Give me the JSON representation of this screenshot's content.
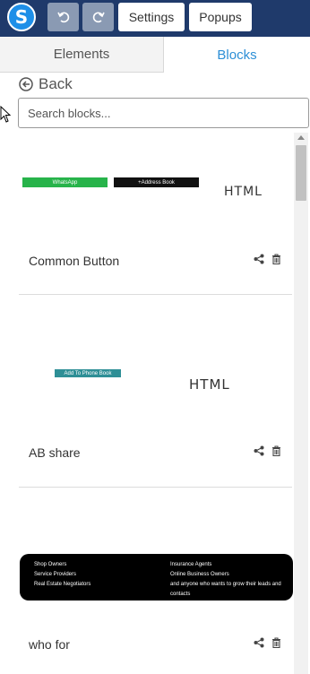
{
  "toolbar": {
    "logo_letter": "S",
    "undo_icon": "undo-icon",
    "redo_icon": "redo-icon",
    "settings_label": "Settings",
    "popups_label": "Popups"
  },
  "tabs": [
    {
      "label": "Elements",
      "active": false
    },
    {
      "label": "Blocks",
      "active": true
    }
  ],
  "back_label": "Back",
  "search": {
    "placeholder": "Search blocks...",
    "value": ""
  },
  "blocks": [
    {
      "name": "Common Button",
      "preview_label": "HTML",
      "preview_buttons": [
        "WhatsApp",
        "+Address Book"
      ]
    },
    {
      "name": "AB share",
      "preview_label": "HTML",
      "preview_buttons": [
        "Add To Phone Book"
      ]
    },
    {
      "name": "who for",
      "preview_left": [
        "Shop Owners",
        "Service Providers",
        "Real Estate Negotiators"
      ],
      "preview_right": [
        "Insurance Agents",
        "Online Business Owners",
        "and anyone who wants to grow their leads and",
        "contacts"
      ]
    }
  ],
  "colors": {
    "topbar": "#1f3a6b",
    "active_tab": "#2d8fd6",
    "whatsapp_green": "#27b34a",
    "teal": "#2e8f96"
  }
}
